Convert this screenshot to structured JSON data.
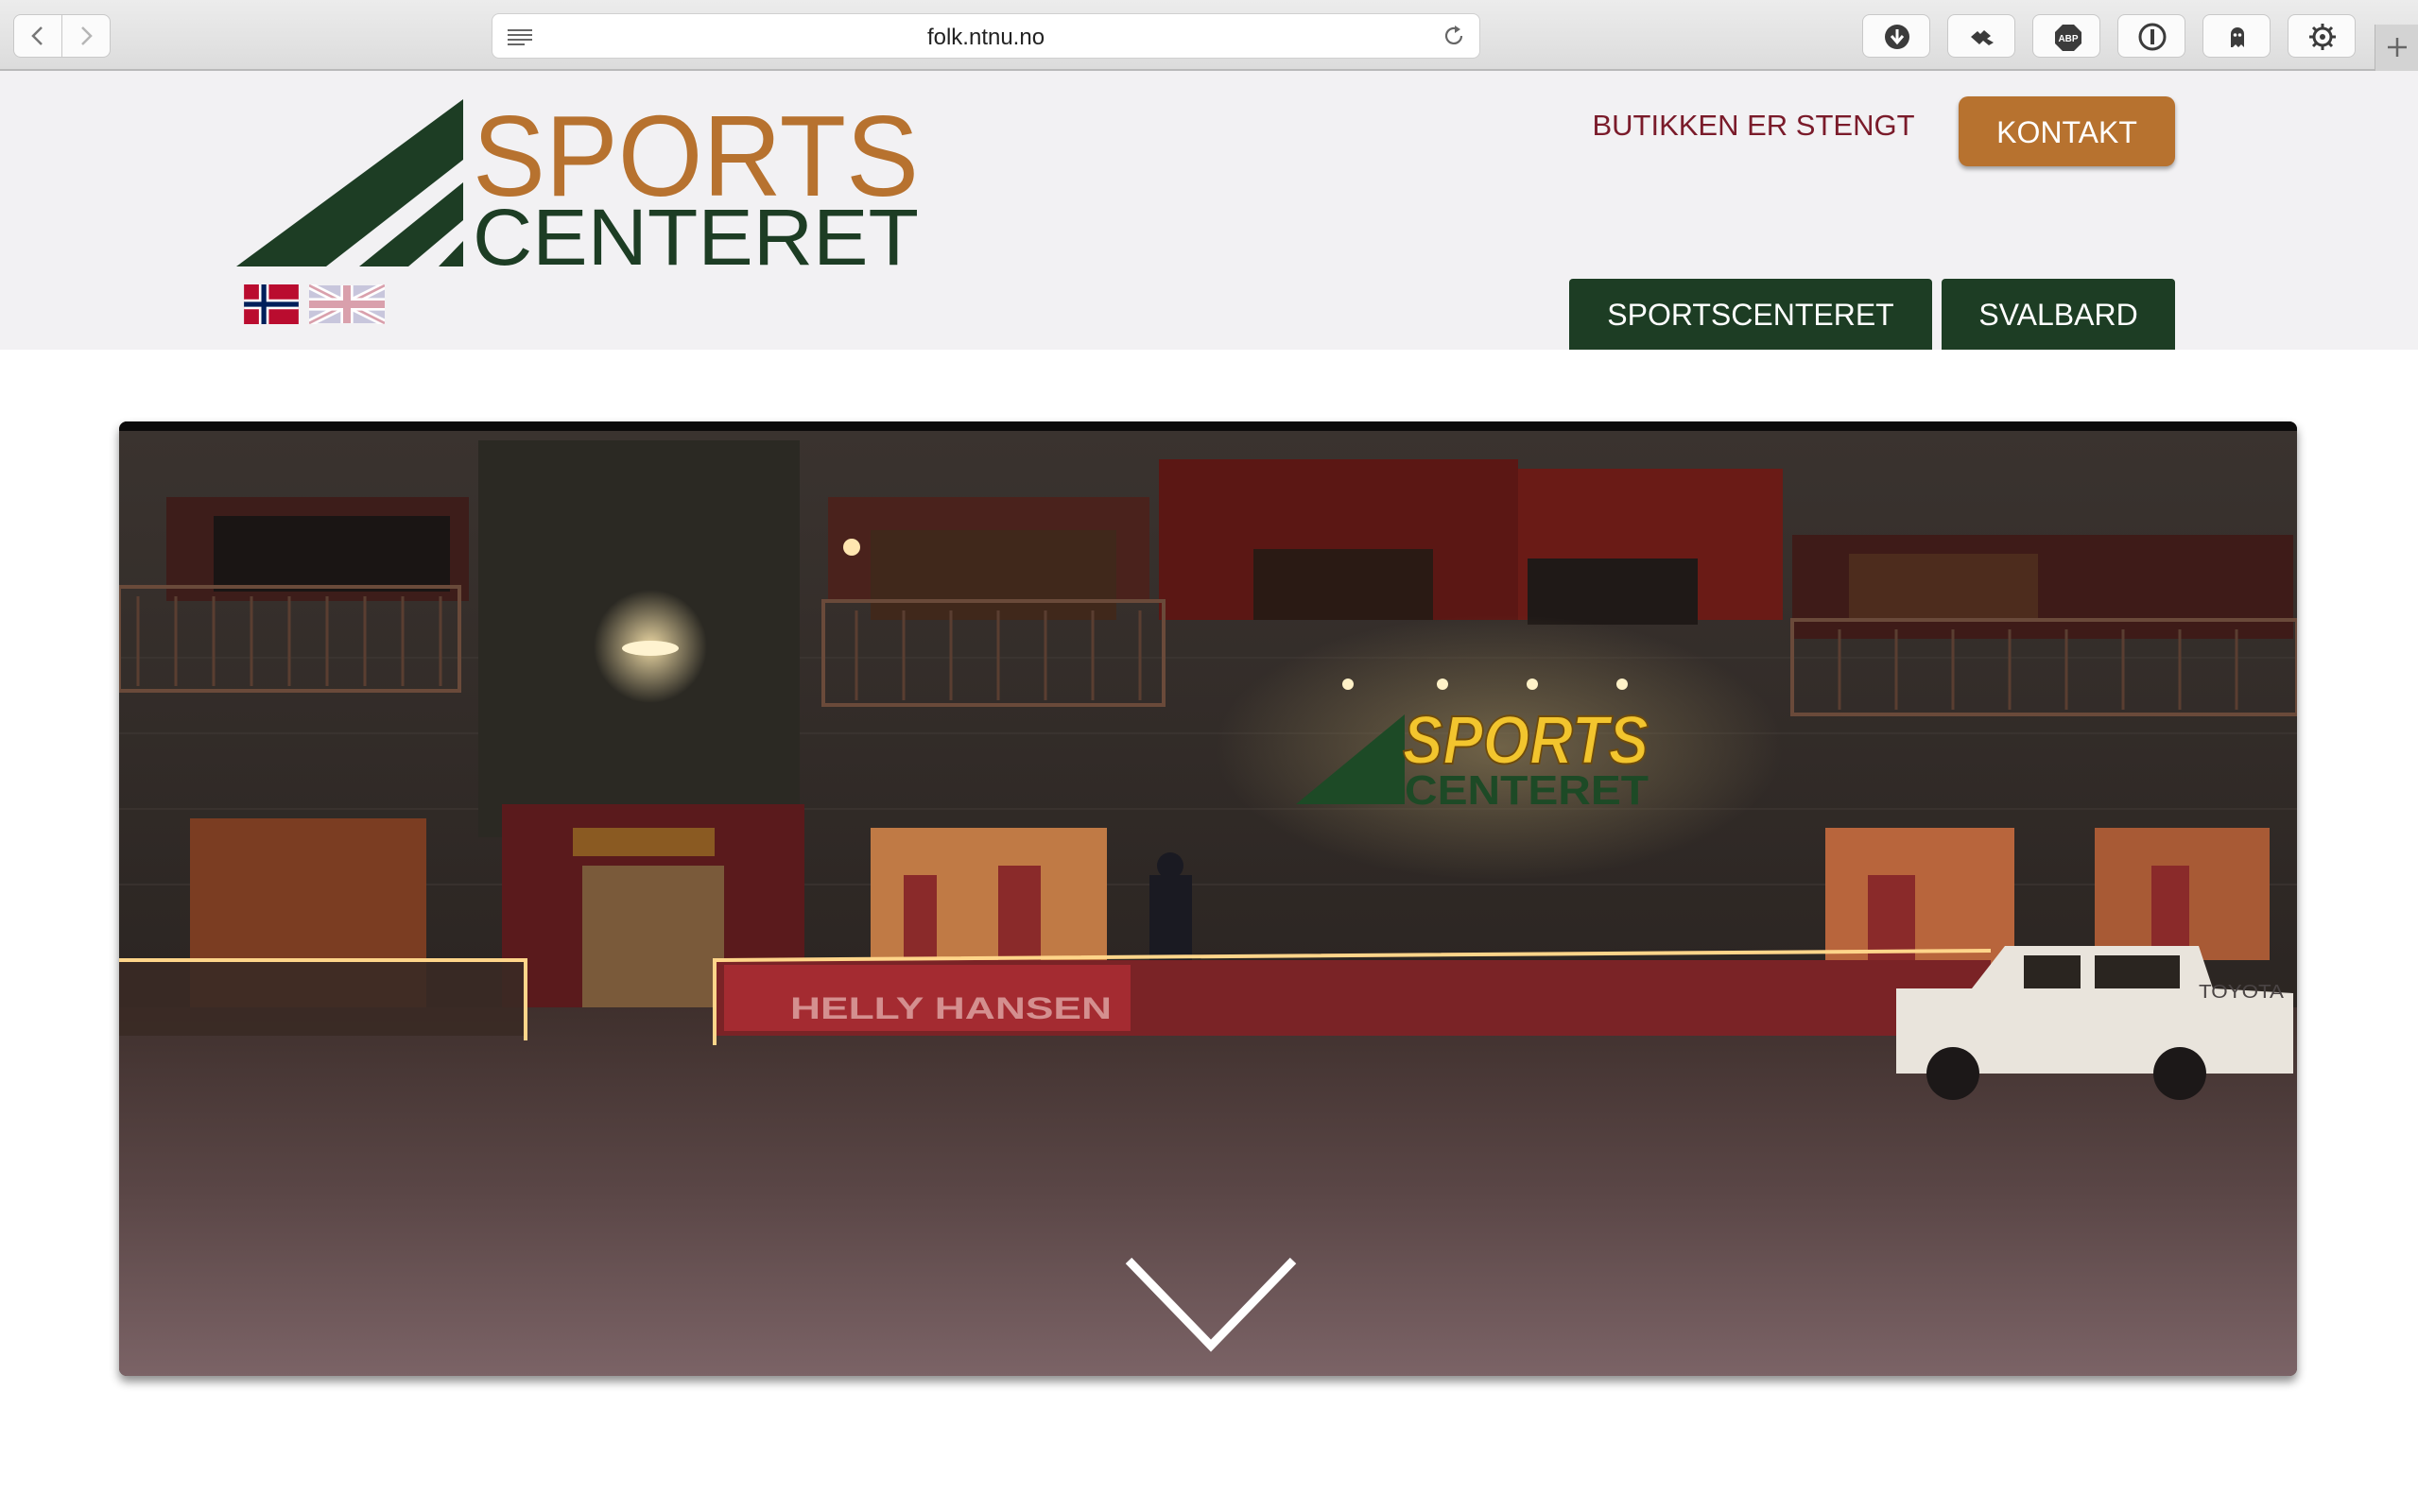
{
  "browser": {
    "url": "folk.ntnu.no",
    "toolbar_icons": [
      "download-icon",
      "puzzle-extension-icon",
      "adblock-icon",
      "password-manager-icon",
      "ghostery-icon",
      "settings-gear-icon"
    ]
  },
  "header": {
    "logo": {
      "line1": "SPORTS",
      "line2": "CENTERET"
    },
    "languages": [
      "norwegian-flag",
      "uk-flag"
    ],
    "store_status": "BUTIKKEN ER STENGT",
    "contact_button": "KONTAKT",
    "tabs": [
      {
        "label": "SPORTSCENTERET"
      },
      {
        "label": "SVALBARD"
      }
    ]
  },
  "hero": {
    "image": "Night photo of the Sportscenteret store front in the snow",
    "storefront_sign": {
      "line1": "SPORTS",
      "line2": "CENTERET"
    },
    "banner_text": "HELLY HANSEN",
    "truck_text": "TOYOTA",
    "scroll_hint": "chevron-down-icon"
  },
  "colors": {
    "brand_green": "#1d3d24",
    "brand_orange": "#b7722f",
    "closed_text": "#7a1b2a",
    "header_bg": "#f2f1f3"
  }
}
